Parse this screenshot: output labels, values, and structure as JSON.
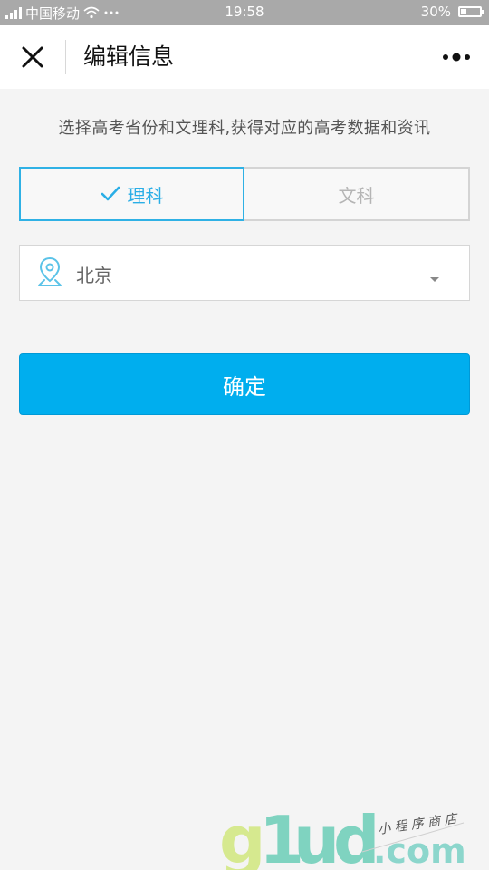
{
  "status_bar": {
    "carrier": "中国移动",
    "time": "19:58",
    "battery": "30%"
  },
  "nav": {
    "title": "编辑信息"
  },
  "hint": "选择高考省份和文理科,获得对应的高考数据和资讯",
  "tabs": {
    "science": "理科",
    "arts": "文科",
    "selected": "science"
  },
  "province": {
    "value": "北京"
  },
  "confirm_label": "确定",
  "watermark": {
    "brand": "g1ud",
    "domain": ".com",
    "tagline": "小程序商店"
  },
  "colors": {
    "accent": "#00aeee",
    "selected_border": "#2fb1e5",
    "status_bar": "#a9a9a9"
  },
  "icons": [
    "close-icon",
    "more-icon",
    "check-icon",
    "location-pin-icon",
    "caret-down-icon",
    "wifi-icon",
    "signal-icon",
    "battery-icon"
  ]
}
